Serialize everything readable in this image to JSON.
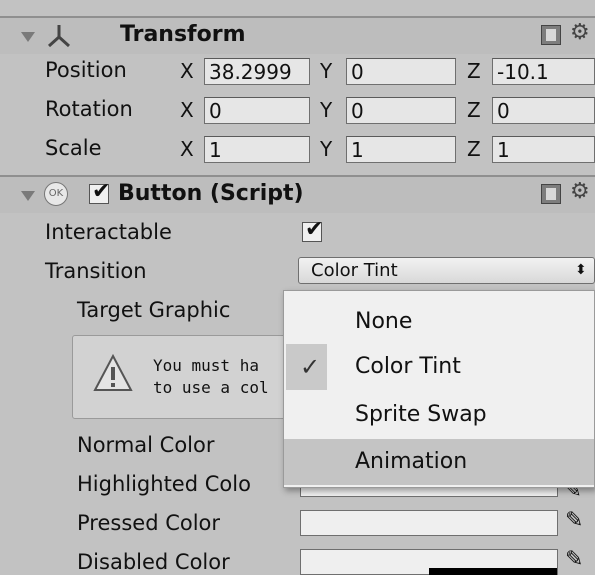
{
  "transform": {
    "title": "Transform",
    "rows": [
      {
        "label": "Position",
        "x": "38.2999",
        "y": "0",
        "z": "-10.1"
      },
      {
        "label": "Rotation",
        "x": "0",
        "y": "0",
        "z": "0"
      },
      {
        "label": "Scale",
        "x": "1",
        "y": "1",
        "z": "1"
      }
    ],
    "axis_x": "X",
    "axis_y": "Y",
    "axis_z": "Z"
  },
  "button_script": {
    "title": "Button (Script)",
    "ok_badge": "OK",
    "enabled": true,
    "interactable_label": "Interactable",
    "interactable": true,
    "transition_label": "Transition",
    "transition_value": "Color Tint",
    "target_graphic_label": "Target Graphic",
    "help_line1": "You must ha",
    "help_line2": "to use a col",
    "normal_color_label": "Normal Color",
    "highlighted_color_label": "Highlighted Colo",
    "pressed_color_label": "Pressed Color",
    "disabled_color_label": "Disabled Color"
  },
  "transition_menu": {
    "options": [
      "None",
      "Color Tint",
      "Sprite Swap",
      "Animation"
    ],
    "selected": "Color Tint",
    "hovered": "Animation"
  }
}
